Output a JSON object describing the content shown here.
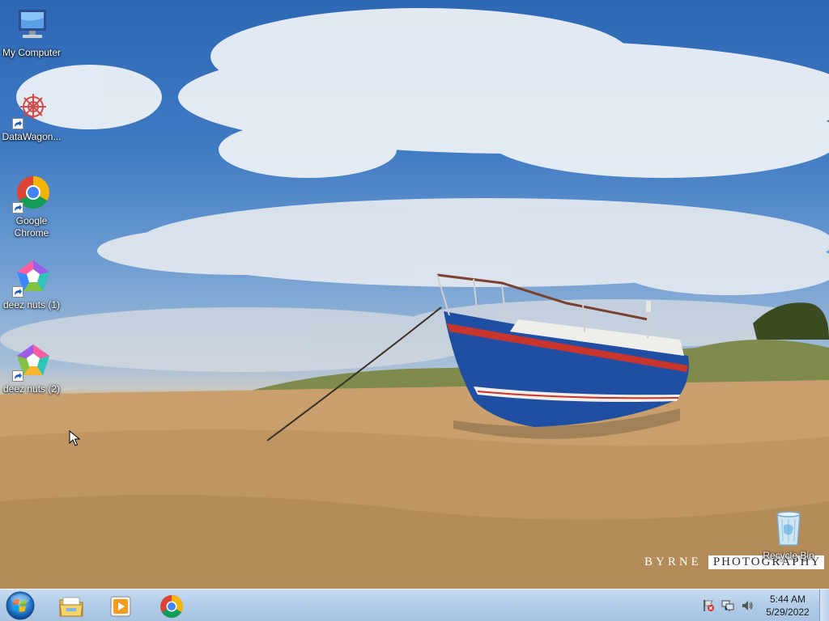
{
  "desktop_icons": [
    {
      "label": "My Computer",
      "icon": "computer-icon",
      "shortcut": false
    },
    {
      "label": "DataWagon...",
      "icon": "datawagon-icon",
      "shortcut": true
    },
    {
      "label": "Google Chrome",
      "icon": "chrome-icon",
      "shortcut": true
    },
    {
      "label": "deez nuts (1)",
      "icon": "pentagon-app-icon",
      "shortcut": true
    },
    {
      "label": "deez nuts (2)",
      "icon": "pentagon-app-icon",
      "shortcut": true
    },
    {
      "label": "Recycle Bin",
      "icon": "recycle-bin-icon",
      "shortcut": false
    }
  ],
  "wallpaper": {
    "watermark_left": "BYRNE",
    "watermark_right": "PHOTOGRAPHY"
  },
  "taskbar": {
    "start_icon": "windows-orb-icon",
    "pinned": [
      {
        "icon": "file-explorer-icon"
      },
      {
        "icon": "media-player-icon"
      },
      {
        "icon": "chrome-icon"
      }
    ],
    "tray": [
      {
        "icon": "action-center-flag-icon"
      },
      {
        "icon": "network-icon"
      },
      {
        "icon": "volume-icon"
      }
    ],
    "clock": {
      "time": "5:44 AM",
      "date": "5/29/2022"
    }
  },
  "colors": {
    "taskbar": "#b3cde8",
    "label_text": "#ffffff",
    "boat_hull": "#1f4ea3",
    "sand": "#c89e6b",
    "sky": "#3f7ac3"
  }
}
